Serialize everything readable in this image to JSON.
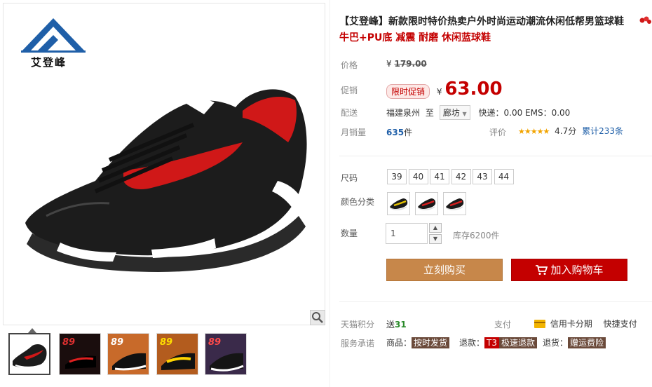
{
  "brand": {
    "logo_text": "艾登峰"
  },
  "product": {
    "title": "【艾登峰】新款限时特价热卖户外时尚运动潮流休闲低帮男篮球鞋",
    "subtitle": "牛巴+PU底 减震 耐磨 休闲蓝球鞋"
  },
  "price": {
    "label": "价格",
    "currency": "¥",
    "original": "179.00",
    "promo_label": "促销",
    "promo_badge": "限时促销",
    "promo_price": "63.00"
  },
  "shipping": {
    "label": "配送",
    "from": "福建泉州",
    "to_word": "至",
    "destination": "廊坊",
    "fees": "快递：0.00 EMS：0.00"
  },
  "sales": {
    "label": "月销量",
    "count": "635",
    "unit": "件",
    "rating_label": "评价",
    "stars": 4.7,
    "score": "4.7分",
    "reviews": "累计233条"
  },
  "sizes": {
    "label": "尺码",
    "options": [
      "39",
      "40",
      "41",
      "42",
      "43",
      "44"
    ]
  },
  "colors": {
    "label": "颜色分类",
    "accents": [
      "#e6c300",
      "#d81e1e",
      "#d81e1e"
    ]
  },
  "quantity": {
    "label": "数量",
    "value": "1",
    "stock": "库存6200件"
  },
  "actions": {
    "buy": "立刻购买",
    "cart": "加入购物车"
  },
  "points": {
    "label": "天猫积分",
    "prefix": "送",
    "value": "31"
  },
  "payment": {
    "label": "支付",
    "installment": "信用卡分期",
    "quick": "快捷支付"
  },
  "service": {
    "label": "服务承诺",
    "items": [
      {
        "prefix": "商品：",
        "tag": "按时发货"
      },
      {
        "prefix": "退款：",
        "badge": "T3",
        "tag": "极速退款"
      },
      {
        "prefix": "退货：",
        "tag": "赠运费险"
      }
    ]
  },
  "thumbnails": {
    "promo_text": "89"
  },
  "colors_theme": {
    "accent_red": "#c40000",
    "buy_orange": "#c7874a",
    "logo_blue": "#1f5fa8"
  }
}
